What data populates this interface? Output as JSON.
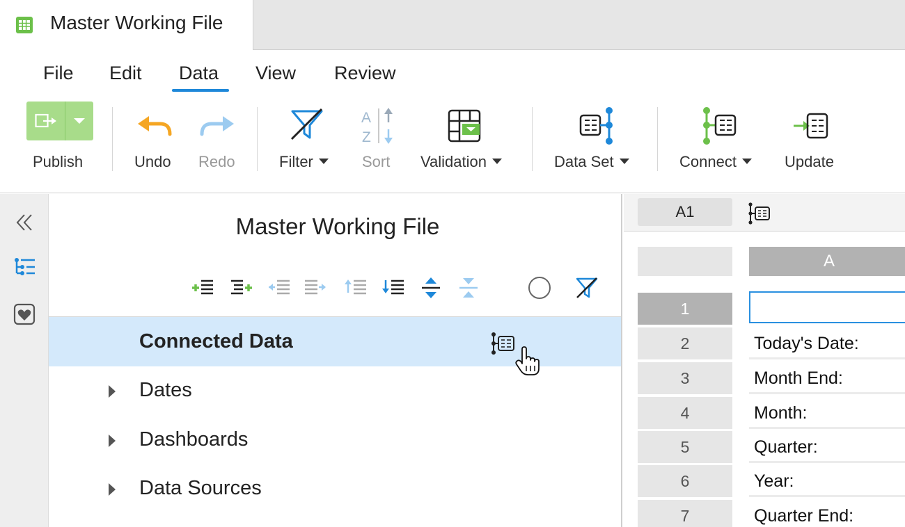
{
  "tab": {
    "title": "Master Working File"
  },
  "menu": {
    "items": [
      "File",
      "Edit",
      "Data",
      "View",
      "Review"
    ],
    "active": "Data"
  },
  "toolbar": {
    "publish": "Publish",
    "undo": "Undo",
    "redo": "Redo",
    "filter": "Filter",
    "sort": "Sort",
    "validation": "Validation",
    "data_set": "Data Set",
    "connect": "Connect",
    "update": "Update"
  },
  "panel": {
    "title": "Master Working File",
    "selected_item": "Connected Data",
    "items": [
      "Dates",
      "Dashboards",
      "Data Sources"
    ]
  },
  "sheet": {
    "cell_ref": "A1",
    "column": "A",
    "rows": [
      {
        "num": "1",
        "value": ""
      },
      {
        "num": "2",
        "value": "Today's Date:"
      },
      {
        "num": "3",
        "value": "Month End:"
      },
      {
        "num": "4",
        "value": "Month:"
      },
      {
        "num": "5",
        "value": "Quarter:"
      },
      {
        "num": "6",
        "value": "Year:"
      },
      {
        "num": "7",
        "value": "Quarter End:"
      }
    ]
  },
  "colors": {
    "accent_blue": "#1e88d9",
    "accent_green": "#6cc04a",
    "orange": "#f5a623",
    "selection": "#d4e9fb"
  }
}
